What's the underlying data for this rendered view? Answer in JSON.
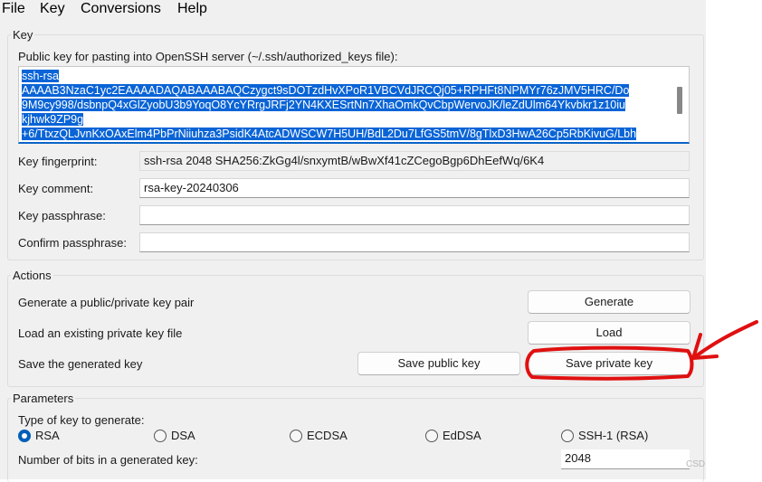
{
  "menu": [
    "File",
    "Key",
    "Conversions",
    "Help"
  ],
  "key_group": {
    "title": "Key",
    "pubkey_label": "Public key for pasting into OpenSSH server (~/.ssh/authorized_keys file):",
    "pubkey_lines": [
      "ssh-rsa",
      "AAAAB3NzaC1yc2EAAAADAQABAAABAQCzygct9sDOTzdHvXPoR1VBCVdJRCQj05+RPHFt8NPMYr76zJMV5HRC/Do",
      "9M9cy998/dsbnpQ4xGlZyobU3b9YoqO8YcYRrgJRFj2YN4KXESrtNn7XhaOmkQvCbpWervoJK/leZdUlm64Ykvbkr1z10iu",
      "kjhwk9ZP9g",
      "+6/TtxzQLJvnKxOAxElm4PbPrNiiuhza3PsidK4AtcADWSCW7H5UH/BdL2Du7LfGS5tmV/8gTlxD3HwA26Cp5RbKivuG/Lbh"
    ],
    "fingerprint_label": "Key fingerprint:",
    "fingerprint_value": "ssh-rsa 2048 SHA256:ZkGg4l/snxymtB/wBwXf41cZCegoBgp6DhEefWq/6K4",
    "comment_label": "Key comment:",
    "comment_value": "rsa-key-20240306",
    "passphrase_label": "Key passphrase:",
    "passphrase_value": "",
    "confirm_label": "Confirm passphrase:",
    "confirm_value": ""
  },
  "actions_group": {
    "title": "Actions",
    "generate_label": "Generate a public/private key pair",
    "generate_button": "Generate",
    "load_label": "Load an existing private key file",
    "load_button": "Load",
    "save_label": "Save the generated key",
    "save_public_button": "Save public key",
    "save_private_button": "Save private key"
  },
  "parameters_group": {
    "title": "Parameters",
    "type_label": "Type of key to generate:",
    "key_types": [
      "RSA",
      "DSA",
      "ECDSA",
      "EdDSA",
      "SSH-1 (RSA)"
    ],
    "selected_type": "RSA",
    "bits_label": "Number of bits in a generated key:",
    "bits_value": "2048"
  },
  "watermark": "CSD",
  "annotation_color": "#e01010"
}
